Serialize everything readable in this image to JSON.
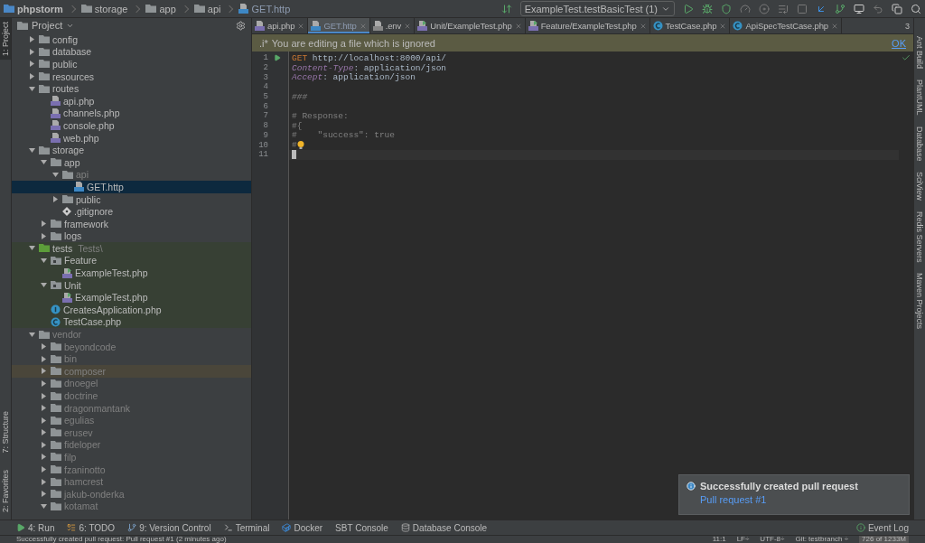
{
  "breadcrumb": [
    {
      "label": "phpstorm",
      "kind": "project"
    },
    {
      "label": "storage",
      "kind": "folder"
    },
    {
      "label": "app",
      "kind": "folder"
    },
    {
      "label": "api",
      "kind": "folder"
    },
    {
      "label": "GET.http",
      "kind": "http"
    }
  ],
  "run_config": {
    "label": "ExampleTest.testBasicTest (1)"
  },
  "left_strip": [
    {
      "label": "1: Project",
      "selected": true
    },
    {
      "label": "7: Structure",
      "selected": false
    },
    {
      "label": "2: Favorites",
      "selected": false
    }
  ],
  "project": {
    "title": "Project",
    "tree": [
      {
        "label": "config",
        "kind": "folder",
        "expanded": false,
        "selected": false,
        "dimmed": false,
        "hovered": false
      },
      {
        "label": "database",
        "kind": "folder",
        "expanded": false,
        "selected": false,
        "dimmed": false,
        "hovered": false
      },
      {
        "label": "public",
        "kind": "folder",
        "expanded": false,
        "selected": false,
        "dimmed": false,
        "hovered": false
      },
      {
        "label": "resources",
        "kind": "folder",
        "expanded": false,
        "selected": false,
        "dimmed": false,
        "hovered": false
      },
      {
        "label": "routes",
        "kind": "folder",
        "expanded": true,
        "selected": false,
        "dimmed": false,
        "hovered": false,
        "children": [
          {
            "label": "api.php",
            "kind": "php",
            "selected": false,
            "dimmed": false,
            "hovered": false
          },
          {
            "label": "channels.php",
            "kind": "php",
            "selected": false,
            "dimmed": false,
            "hovered": false
          },
          {
            "label": "console.php",
            "kind": "php",
            "selected": false,
            "dimmed": false,
            "hovered": false
          },
          {
            "label": "web.php",
            "kind": "php",
            "selected": false,
            "dimmed": false,
            "hovered": false
          }
        ]
      },
      {
        "label": "storage",
        "kind": "folder",
        "expanded": true,
        "selected": false,
        "dimmed": false,
        "hovered": false,
        "children": [
          {
            "label": "app",
            "kind": "folder",
            "expanded": true,
            "selected": false,
            "dimmed": false,
            "hovered": false,
            "children": [
              {
                "label": "api",
                "kind": "folder",
                "expanded": true,
                "selected": false,
                "dimmed": true,
                "hovered": false,
                "children": [
                  {
                    "label": "GET.http",
                    "kind": "http",
                    "selected": true,
                    "dimmed": false,
                    "hovered": false
                  }
                ]
              },
              {
                "label": "public",
                "kind": "folder",
                "expanded": false,
                "selected": false,
                "dimmed": false,
                "hovered": false
              },
              {
                "label": ".gitignore",
                "kind": "git",
                "selected": false,
                "dimmed": false,
                "hovered": false
              }
            ]
          },
          {
            "label": "framework",
            "kind": "folder",
            "expanded": false,
            "selected": false,
            "dimmed": false,
            "hovered": false
          },
          {
            "label": "logs",
            "kind": "folder",
            "expanded": false,
            "selected": false,
            "dimmed": false,
            "hovered": false
          }
        ]
      },
      {
        "label": "tests",
        "namespace": "Tests\\",
        "kind": "test-folder",
        "expanded": true,
        "selected": false,
        "dimmed": false,
        "hovered": false,
        "children": [
          {
            "label": "Feature",
            "kind": "package",
            "expanded": true,
            "selected": false,
            "dimmed": false,
            "hovered": false,
            "children": [
              {
                "label": "ExampleTest.php",
                "kind": "test-php",
                "selected": false,
                "dimmed": false,
                "hovered": false
              }
            ]
          },
          {
            "label": "Unit",
            "kind": "package",
            "expanded": true,
            "selected": false,
            "dimmed": false,
            "hovered": false,
            "children": [
              {
                "label": "ExampleTest.php",
                "kind": "test-php",
                "selected": false,
                "dimmed": false,
                "hovered": false
              }
            ]
          },
          {
            "label": "CreatesApplication.php",
            "kind": "interface",
            "selected": false,
            "dimmed": false,
            "hovered": false
          },
          {
            "label": "TestCase.php",
            "kind": "class",
            "selected": false,
            "dimmed": false,
            "hovered": false
          }
        ]
      },
      {
        "label": "vendor",
        "kind": "folder",
        "expanded": true,
        "selected": false,
        "dimmed": true,
        "hovered": false,
        "children": [
          {
            "label": "beyondcode",
            "kind": "folder",
            "expanded": false,
            "selected": false,
            "dimmed": true,
            "hovered": false
          },
          {
            "label": "bin",
            "kind": "folder",
            "expanded": false,
            "selected": false,
            "dimmed": true,
            "hovered": false
          },
          {
            "label": "composer",
            "kind": "folder",
            "expanded": false,
            "selected": false,
            "dimmed": true,
            "hovered": true
          },
          {
            "label": "dnoegel",
            "kind": "folder",
            "expanded": false,
            "selected": false,
            "dimmed": true,
            "hovered": false
          },
          {
            "label": "doctrine",
            "kind": "folder",
            "expanded": false,
            "selected": false,
            "dimmed": true,
            "hovered": false
          },
          {
            "label": "dragonmantank",
            "kind": "folder",
            "expanded": false,
            "selected": false,
            "dimmed": true,
            "hovered": false
          },
          {
            "label": "egulias",
            "kind": "folder",
            "expanded": false,
            "selected": false,
            "dimmed": true,
            "hovered": false
          },
          {
            "label": "erusev",
            "kind": "folder",
            "expanded": false,
            "selected": false,
            "dimmed": true,
            "hovered": false
          },
          {
            "label": "fideloper",
            "kind": "folder",
            "expanded": false,
            "selected": false,
            "dimmed": true,
            "hovered": false
          },
          {
            "label": "filp",
            "kind": "folder",
            "expanded": false,
            "selected": false,
            "dimmed": true,
            "hovered": false
          },
          {
            "label": "fzaninotto",
            "kind": "folder",
            "expanded": false,
            "selected": false,
            "dimmed": true,
            "hovered": false
          },
          {
            "label": "hamcrest",
            "kind": "folder",
            "expanded": false,
            "selected": false,
            "dimmed": true,
            "hovered": false
          },
          {
            "label": "jakub-onderka",
            "kind": "folder",
            "expanded": false,
            "selected": false,
            "dimmed": true,
            "hovered": false
          },
          {
            "label": "kotamat",
            "kind": "folder",
            "expanded": true,
            "selected": false,
            "dimmed": true,
            "hovered": false
          }
        ]
      }
    ]
  },
  "tabs": [
    {
      "label": "api.php",
      "kind": "php",
      "selected": false
    },
    {
      "label": "GET.http",
      "kind": "http",
      "selected": true
    },
    {
      "label": ".env",
      "kind": "file",
      "selected": false
    },
    {
      "label": "Unit/ExampleTest.php",
      "kind": "test-php",
      "selected": false
    },
    {
      "label": "Feature/ExampleTest.php",
      "kind": "test-php",
      "selected": false
    },
    {
      "label": "TestCase.php",
      "kind": "class",
      "selected": false
    },
    {
      "label": "ApiSpecTestCase.php",
      "kind": "class",
      "selected": false
    }
  ],
  "tabs_overflow": "3",
  "banner": {
    "icon": ".i*",
    "text": "You are editing a file which is ignored",
    "action": "OK"
  },
  "editor": {
    "lines": [
      {
        "number": "1",
        "run": true,
        "current": false,
        "tokens": [
          {
            "text": "GET",
            "kind": "method"
          },
          {
            "text": " http://localhost:8000/api/",
            "kind": "plain"
          }
        ]
      },
      {
        "number": "2",
        "current": false,
        "tokens": [
          {
            "text": "Content-Type",
            "kind": "header"
          },
          {
            "text": ": application/json",
            "kind": "plain"
          }
        ]
      },
      {
        "number": "3",
        "current": false,
        "tokens": [
          {
            "text": "Accept",
            "kind": "header"
          },
          {
            "text": ": application/json",
            "kind": "plain"
          }
        ]
      },
      {
        "number": "4",
        "current": false
      },
      {
        "number": "5",
        "current": false,
        "tokens": [
          {
            "text": "###",
            "kind": "separator"
          }
        ]
      },
      {
        "number": "6",
        "current": false
      },
      {
        "number": "7",
        "current": false,
        "tokens": [
          {
            "text": "# Response:",
            "kind": "comment"
          }
        ]
      },
      {
        "number": "8",
        "current": false,
        "tokens": [
          {
            "text": "#{",
            "kind": "comment"
          }
        ]
      },
      {
        "number": "9",
        "current": false,
        "tokens": [
          {
            "text": "#    \"success\": true",
            "kind": "comment"
          }
        ]
      },
      {
        "number": "10",
        "bulb": true,
        "current": false,
        "tokens": [
          {
            "text": "#",
            "kind": "comment"
          }
        ]
      },
      {
        "number": "11",
        "current": true
      }
    ]
  },
  "right_strip": [
    {
      "label": "Ant Build"
    },
    {
      "label": "PlantUML"
    },
    {
      "label": "Database"
    },
    {
      "label": "SciView"
    },
    {
      "label": "Redis Servers"
    },
    {
      "label": "Maven Projects"
    }
  ],
  "notification": {
    "title": "Successfully created pull request",
    "link": "Pull request #1"
  },
  "tool_windows": [
    {
      "label": "4: Run",
      "kind": "run"
    },
    {
      "label": "6: TODO",
      "kind": "todo"
    },
    {
      "label": "9: Version Control",
      "kind": "vcs"
    },
    {
      "label": "Terminal",
      "kind": "terminal"
    },
    {
      "label": "Docker",
      "kind": "docker"
    },
    {
      "label": "SBT Console"
    },
    {
      "label": "Database Console",
      "kind": "db"
    }
  ],
  "event_log": "Event Log",
  "status_bar": {
    "message": "Successfully created pull request: Pull request #1 (2 minutes ago)",
    "items": [
      "11:1",
      "LF÷",
      "UTF-8÷",
      "Git: testbranch ÷"
    ],
    "memory": "726 of 1233M"
  }
}
